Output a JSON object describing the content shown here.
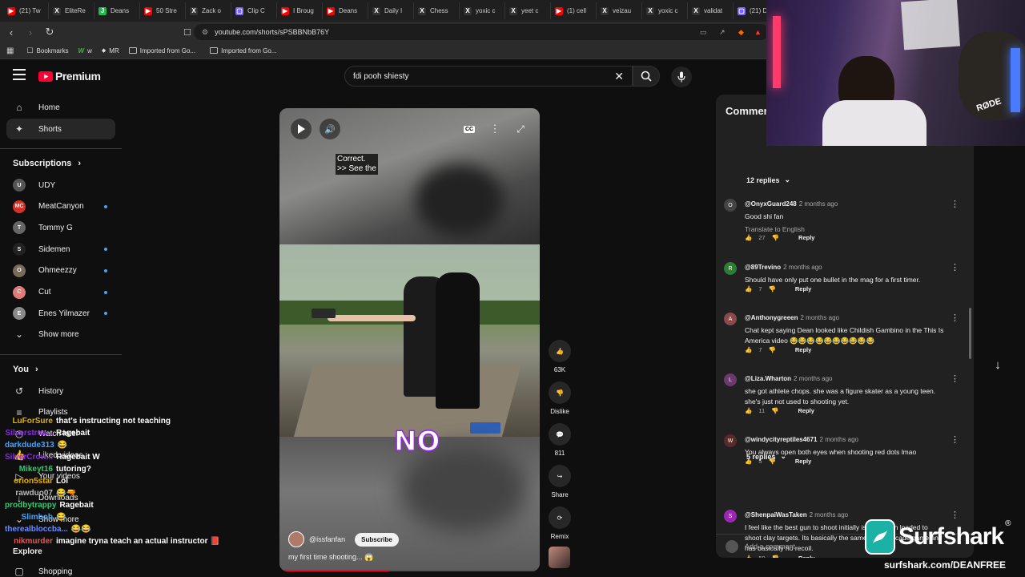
{
  "browser": {
    "tabs": [
      {
        "label": "(21) Tw",
        "color": "#ff0000",
        "glyph": "▶"
      },
      {
        "label": "EliteRe",
        "color": "#333333",
        "glyph": "X"
      },
      {
        "label": "Deans",
        "color": "#1db954",
        "glyph": "J"
      },
      {
        "label": "50 Stre",
        "color": "#ff0000",
        "glyph": "▶"
      },
      {
        "label": "Zack o",
        "color": "#333333",
        "glyph": "X"
      },
      {
        "label": "Clip C",
        "color": "#7b61ff",
        "glyph": "▢"
      },
      {
        "label": "I Broug",
        "color": "#ff0000",
        "glyph": "▶"
      },
      {
        "label": "Deans",
        "color": "#ff0000",
        "glyph": "▶"
      },
      {
        "label": "Daily I",
        "color": "#333333",
        "glyph": "X"
      },
      {
        "label": "Chess",
        "color": "#333333",
        "glyph": "X"
      },
      {
        "label": "yoxic c",
        "color": "#333333",
        "glyph": "X"
      },
      {
        "label": "yeet c",
        "color": "#333333",
        "glyph": "X"
      },
      {
        "label": "(1) cell",
        "color": "#ff0000",
        "glyph": "▶"
      },
      {
        "label": "veizau",
        "color": "#333333",
        "glyph": "X"
      },
      {
        "label": "yoxic c",
        "color": "#333333",
        "glyph": "X"
      },
      {
        "label": "validat",
        "color": "#333333",
        "glyph": "X"
      },
      {
        "label": "(21) D",
        "color": "#7b61ff",
        "glyph": "▢"
      }
    ],
    "url": "youtube.com/shorts/sPSBBNbB76Y",
    "bookmarks": [
      {
        "label": "Bookmarks",
        "icon": "star-icon"
      },
      {
        "label": "w",
        "icon": "w-icon"
      },
      {
        "label": "MR",
        "icon": "mr-icon"
      },
      {
        "label": "Imported from Go...",
        "icon": "folder-icon"
      },
      {
        "label": "Imported from Go...",
        "icon": "folder-icon"
      }
    ]
  },
  "youtube": {
    "brand": "Premium",
    "search_value": "fdi pooh shiesty",
    "sidebar": {
      "primary": [
        {
          "label": "Home",
          "icon": "home-icon",
          "glyph": "⌂"
        },
        {
          "label": "Shorts",
          "icon": "shorts-icon",
          "glyph": "✦"
        }
      ],
      "subscriptions_heading": "Subscriptions",
      "subscriptions": [
        {
          "label": "UDY",
          "initials": "U",
          "color": "#555555",
          "dot": false
        },
        {
          "label": "MeatCanyon",
          "initials": "MC",
          "color": "#d93025",
          "dot": true
        },
        {
          "label": "Tommy G",
          "initials": "T",
          "color": "#666666",
          "dot": false
        },
        {
          "label": "Sidemen",
          "initials": "S",
          "color": "#222222",
          "dot": true
        },
        {
          "label": "Ohmeezzy",
          "initials": "O",
          "color": "#7a6a5a",
          "dot": true
        },
        {
          "label": "Cut",
          "initials": "C",
          "color": "#e07b7b",
          "dot": true
        },
        {
          "label": "Enes Yilmazer",
          "initials": "E",
          "color": "#8a8a8a",
          "dot": true
        }
      ],
      "show_more": "Show more",
      "you_heading": "You",
      "you_items": [
        {
          "label": "History",
          "glyph": "↺"
        },
        {
          "label": "Playlists",
          "glyph": "≡"
        },
        {
          "label": "Watch later",
          "glyph": "◷"
        },
        {
          "label": "Liked videos",
          "glyph": "👍"
        },
        {
          "label": "Your videos",
          "glyph": "▷"
        },
        {
          "label": "Downloads",
          "glyph": "↓"
        }
      ],
      "show_more_2": "Show more",
      "explore_heading": "Explore",
      "explore_items": [
        {
          "label": "Shopping"
        }
      ]
    },
    "short": {
      "caption": "Correct.\n>> See the",
      "overlay_text": "NO",
      "channel": "@issfanfan",
      "subscribe": "Subscribe",
      "title": "my first time shooting... 😱",
      "progress": 0.42,
      "actions": [
        {
          "label": "63K",
          "icon": "like-icon",
          "glyph": "👍"
        },
        {
          "label": "Dislike",
          "icon": "dislike-icon",
          "glyph": "👎"
        },
        {
          "label": "811",
          "icon": "comment-icon",
          "glyph": "💬"
        },
        {
          "label": "Share",
          "icon": "share-icon",
          "glyph": "↪"
        },
        {
          "label": "Remix",
          "icon": "remix-icon",
          "glyph": "⟳"
        }
      ]
    },
    "comments": {
      "title": "Comments",
      "top_replies": "12 replies",
      "items": [
        {
          "user": "@OnyxGuard248",
          "ago": "2 months ago",
          "text": "Good shi fan",
          "translate": "Translate to English",
          "likes": "27",
          "avatar_color": "#444444",
          "initials": "O"
        },
        {
          "user": "@89Trevino",
          "ago": "2 months ago",
          "text": "Should have only put one bullet in the mag for a first timer.",
          "likes": "7",
          "avatar_color": "#2e7d32",
          "initials": "R"
        },
        {
          "user": "@Anthonygreeen",
          "ago": "2 months ago",
          "text": "Chat kept saying Dean looked like Childish Gambino in the This Is America video 😂😂😂😂😂😂😂😂😂😂",
          "likes": "7",
          "avatar_color": "#8a4a4a",
          "initials": "A"
        },
        {
          "user": "@Liza.Wharton",
          "ago": "2 months ago",
          "text": "she got athlete chops. she was a figure skater as a young teen. she's just not used to shooting yet.",
          "likes": "11",
          "avatar_color": "#6a3a6a",
          "initials": "L"
        },
        {
          "user": "@windycityreptiles4671",
          "ago": "2 months ago",
          "text": "You always open both eyes when shooting red dots lmao",
          "likes": "5",
          "avatar_color": "#5a2a2a",
          "initials": "W"
        },
        {
          "user": "@ShenpaiWasTaken",
          "ago": "2 months ago",
          "text": "I feel like the best gun to shoot initially is a shotgun loaded to shoot clay targets. Its basically the same as the arcade game and has basically no recoil.",
          "likes": "59",
          "avatar_color": "#9c27b0",
          "initials": "S"
        }
      ],
      "reply_label": "Reply",
      "mid_replies": "5 replies",
      "add_placeholder": "Add a comment..."
    }
  },
  "stream": {
    "chat": [
      {
        "name": "LuForSure",
        "color": "#e0b000",
        "msg": "that's instructing not teaching"
      },
      {
        "name": "Silverstrea...",
        "color": "#8a2be2",
        "msg": "Ragebait"
      },
      {
        "name": "darkdude313",
        "color": "#3ea6ff",
        "msg": "😂"
      },
      {
        "name": "SilverCrow...",
        "color": "#8a2be2",
        "msg": "Ragebait W"
      },
      {
        "name": "Mikeyt16",
        "color": "#2ecc71",
        "msg": "tutoring?"
      },
      {
        "name": "orion5star",
        "color": "#e0b000",
        "msg": "Lol"
      },
      {
        "name": "rawduo07",
        "color": "#bbbbbb",
        "msg": "😂🔫"
      },
      {
        "name": "prodbytrappy",
        "color": "#2ecc71",
        "msg": "Ragebait"
      },
      {
        "name": "Slimbob",
        "color": "#3ea6ff",
        "msg": "😂"
      },
      {
        "name": "therealbloccba...",
        "color": "#6b8cff",
        "msg": "😂😂"
      },
      {
        "name": "nikmurder",
        "color": "#ff4d4d",
        "msg": "imagine tryna teach an actual instructor 📕"
      }
    ],
    "sponsor": "Surfshark",
    "sponsor_url": "surfshark.com/DEANFREE",
    "mic_brand": "RØDE"
  }
}
